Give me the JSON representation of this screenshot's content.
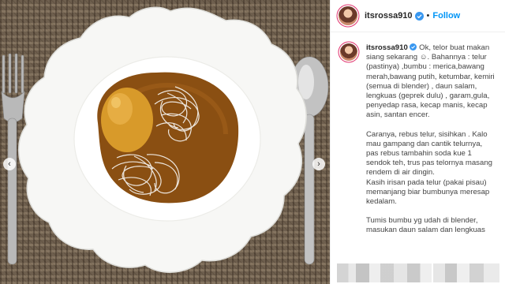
{
  "post": {
    "author": {
      "username": "itsrossa910",
      "verified": true,
      "separator": "•",
      "follow_label": "Follow"
    },
    "photo": {
      "prev_icon": "chevron-left-icon",
      "next_icon": "chevron-right-icon"
    },
    "caption": {
      "username": "itsrossa910",
      "paragraphs": [
        "Ok, telor buat makan siang sekarang ☺. Bahannya : telur (pastinya) ,bumbu : merica,bawang merah,bawang putih, ketumbar, kemiri (semua di blender) , daun salam, lengkuas (geprek dulu) , garam,gula, penyedap rasa, kecap manis, kecap asin, santan encer.",
        "Caranya, rebus telur, sisihkan . Kalo mau gampang dan cantik telurnya, pas rebus tambahin soda kue 1 sendok teh, trus pas telornya masang rendem di air dingin.\nKasih irisan pada telur (pakai pisau) memanjang biar bumbunya meresap kedalam.",
        "Tumis bumbu yg udah di blender,\nmasukan daun salam dan lengkuas"
      ]
    },
    "colors": {
      "accent_blue": "#0095f6",
      "text": "#262626"
    }
  }
}
